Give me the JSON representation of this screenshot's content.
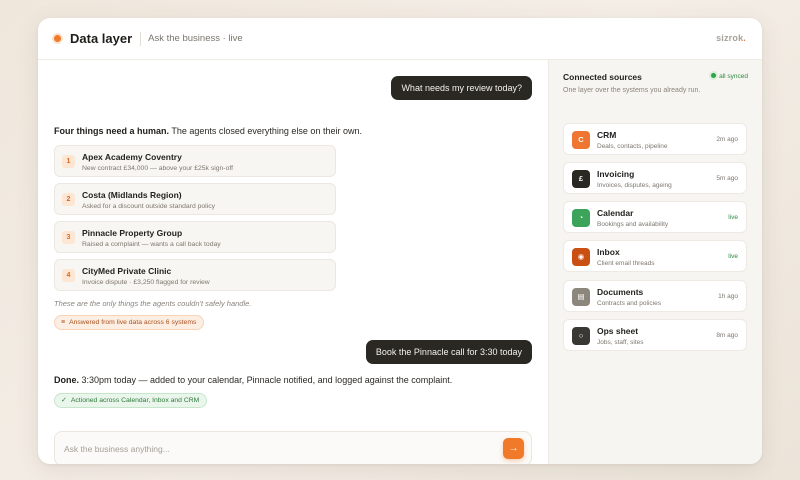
{
  "header": {
    "title": "Data layer",
    "subtitle": "Ask the business · live",
    "logo": "sizrok",
    "logo_suffix": "."
  },
  "chat": {
    "q1": "What needs my review today?",
    "a1_lead_bold": "Four things need a human.",
    "a1_lead_rest": " The agents closed everything else on their own.",
    "items": [
      {
        "num": "1",
        "title": "Apex Academy Coventry",
        "sub": "New contract £34,000 — above your £25k sign-off"
      },
      {
        "num": "2",
        "title": "Costa (Midlands Region)",
        "sub": "Asked for a discount outside standard policy"
      },
      {
        "num": "3",
        "title": "Pinnacle Property Group",
        "sub": "Raised a complaint — wants a call back today"
      },
      {
        "num": "4",
        "title": "CityMed Private Clinic",
        "sub": "Invoice dispute · £3,250 flagged for review"
      }
    ],
    "note": "These are the only things the agents couldn't safely handle.",
    "pill1": "Answered from live data across 6 systems",
    "q2": "Book the Pinnacle call for 3:30 today",
    "a2_bold": "Done.",
    "a2_rest": " 3:30pm today — added to your calendar, Pinnacle notified, and logged against the complaint.",
    "pill2": "Actioned across Calendar, Inbox and CRM",
    "composer_placeholder": "Ask the business anything...",
    "send_icon": "→"
  },
  "sidebar": {
    "title": "Connected sources",
    "subtitle": "One layer over the systems you already run.",
    "synced": "all synced",
    "sources": [
      {
        "name": "CRM",
        "desc": "Deals, contacts, pipeline",
        "time": "2m ago",
        "glyph": "C",
        "color": "#ee7630",
        "icon": "crm-icon"
      },
      {
        "name": "Invoicing",
        "desc": "Invoices, disputes, ageing",
        "time": "5m ago",
        "glyph": "£",
        "color": "#2a2823",
        "icon": "pound-icon"
      },
      {
        "name": "Calendar",
        "desc": "Bookings and availability",
        "time": "live",
        "glyph": "◔",
        "color": "#3ba35a",
        "icon": "calendar-icon"
      },
      {
        "name": "Inbox",
        "desc": "Client email threads",
        "time": "live",
        "glyph": "◉",
        "color": "#c94f12",
        "icon": "inbox-icon"
      },
      {
        "name": "Documents",
        "desc": "Contracts and policies",
        "time": "1h ago",
        "glyph": "▤",
        "color": "#8c867d",
        "icon": "documents-icon"
      },
      {
        "name": "Ops sheet",
        "desc": "Jobs, staff, sites",
        "time": "8m ago",
        "glyph": "○",
        "color": "#3a3833",
        "icon": "ops-sheet-icon"
      }
    ]
  },
  "colors": {
    "accent": "#f07a2a",
    "dark_bubble": "#2a2823",
    "live_green": "#2f8a42"
  }
}
